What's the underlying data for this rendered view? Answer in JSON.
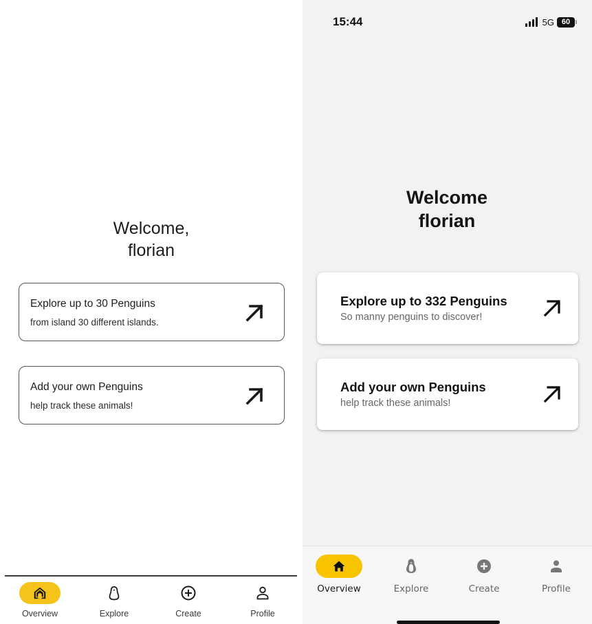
{
  "left": {
    "welcome": {
      "line1": "Welcome,",
      "line2": "florian"
    },
    "cards": [
      {
        "title": "Explore up to 30 Penguins",
        "subtitle": "from island 30 different islands.",
        "icon": "arrow-up-right-icon"
      },
      {
        "title": "Add your own Penguins",
        "subtitle": "help track these animals!",
        "icon": "arrow-up-right-icon"
      }
    ],
    "nav": [
      {
        "label": "Overview",
        "icon": "home-icon",
        "active": true
      },
      {
        "label": "Explore",
        "icon": "penguin-icon",
        "active": false
      },
      {
        "label": "Create",
        "icon": "add-circle-icon",
        "active": false
      },
      {
        "label": "Profile",
        "icon": "person-icon",
        "active": false
      }
    ]
  },
  "right": {
    "status": {
      "time": "15:44",
      "network": "5G",
      "battery": "60"
    },
    "welcome": {
      "line1": "Welcome",
      "line2": "florian"
    },
    "cards": [
      {
        "title": "Explore up to 332 Penguins",
        "subtitle": "So manny penguins to discover!",
        "icon": "arrow-up-right-icon"
      },
      {
        "title": "Add your own Penguins",
        "subtitle": "help track these animals!",
        "icon": "arrow-up-right-icon"
      }
    ],
    "nav": [
      {
        "label": "Overview",
        "icon": "home-icon",
        "active": true
      },
      {
        "label": "Explore",
        "icon": "penguin-icon",
        "active": false
      },
      {
        "label": "Create",
        "icon": "add-circle-icon",
        "active": false
      },
      {
        "label": "Profile",
        "icon": "person-icon",
        "active": false
      }
    ]
  },
  "colors": {
    "accent_left": "#f5c319",
    "accent_right": "#f8c400",
    "right_background": "#f2f2f2"
  }
}
